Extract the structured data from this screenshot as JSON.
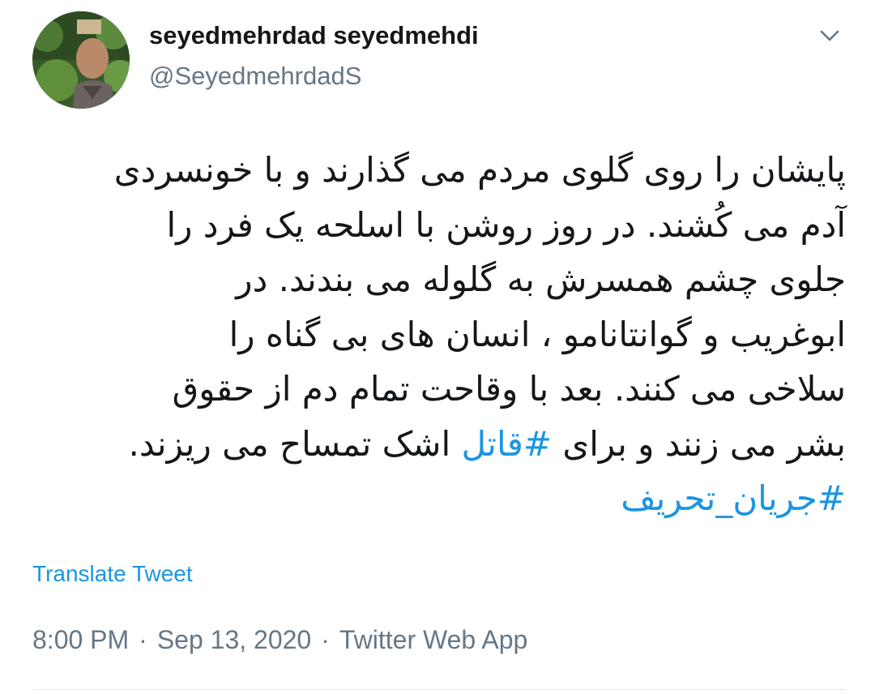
{
  "tweet": {
    "author": {
      "display_name": "seyedmehrdad seyedmehdi",
      "username": "@SeyedmehrdadS"
    },
    "menu_icon": "chevron-down-icon",
    "body": {
      "line1": "پایشان را روی گلوی مردم می گذارند و با خونسردی",
      "line2": "آدم می کُشند. در روز روشن با اسلحه یک فرد را",
      "line3": "جلوی چشم همسرش به گلوله می بندند. در",
      "line4": "ابوغریب و گوانتانامو ، انسان های بی گناه را",
      "line5": "سلاخی می کنند. بعد با وقاحت تمام دم از حقوق",
      "line6_part1": "بشر می زنند و برای ",
      "hashtag1": "#قاتل",
      "line6_part2": " اشک تمساح می ریزند.",
      "hashtag2": "#جریان_تحریف"
    },
    "translate_label": "Translate Tweet",
    "time": "8:00 PM",
    "separator": "·",
    "date": "Sep 13, 2020",
    "source": "Twitter Web App"
  },
  "colors": {
    "text": "#14171a",
    "secondary": "#657786",
    "link": "#1b95e0",
    "divider": "#e1e8ed"
  }
}
